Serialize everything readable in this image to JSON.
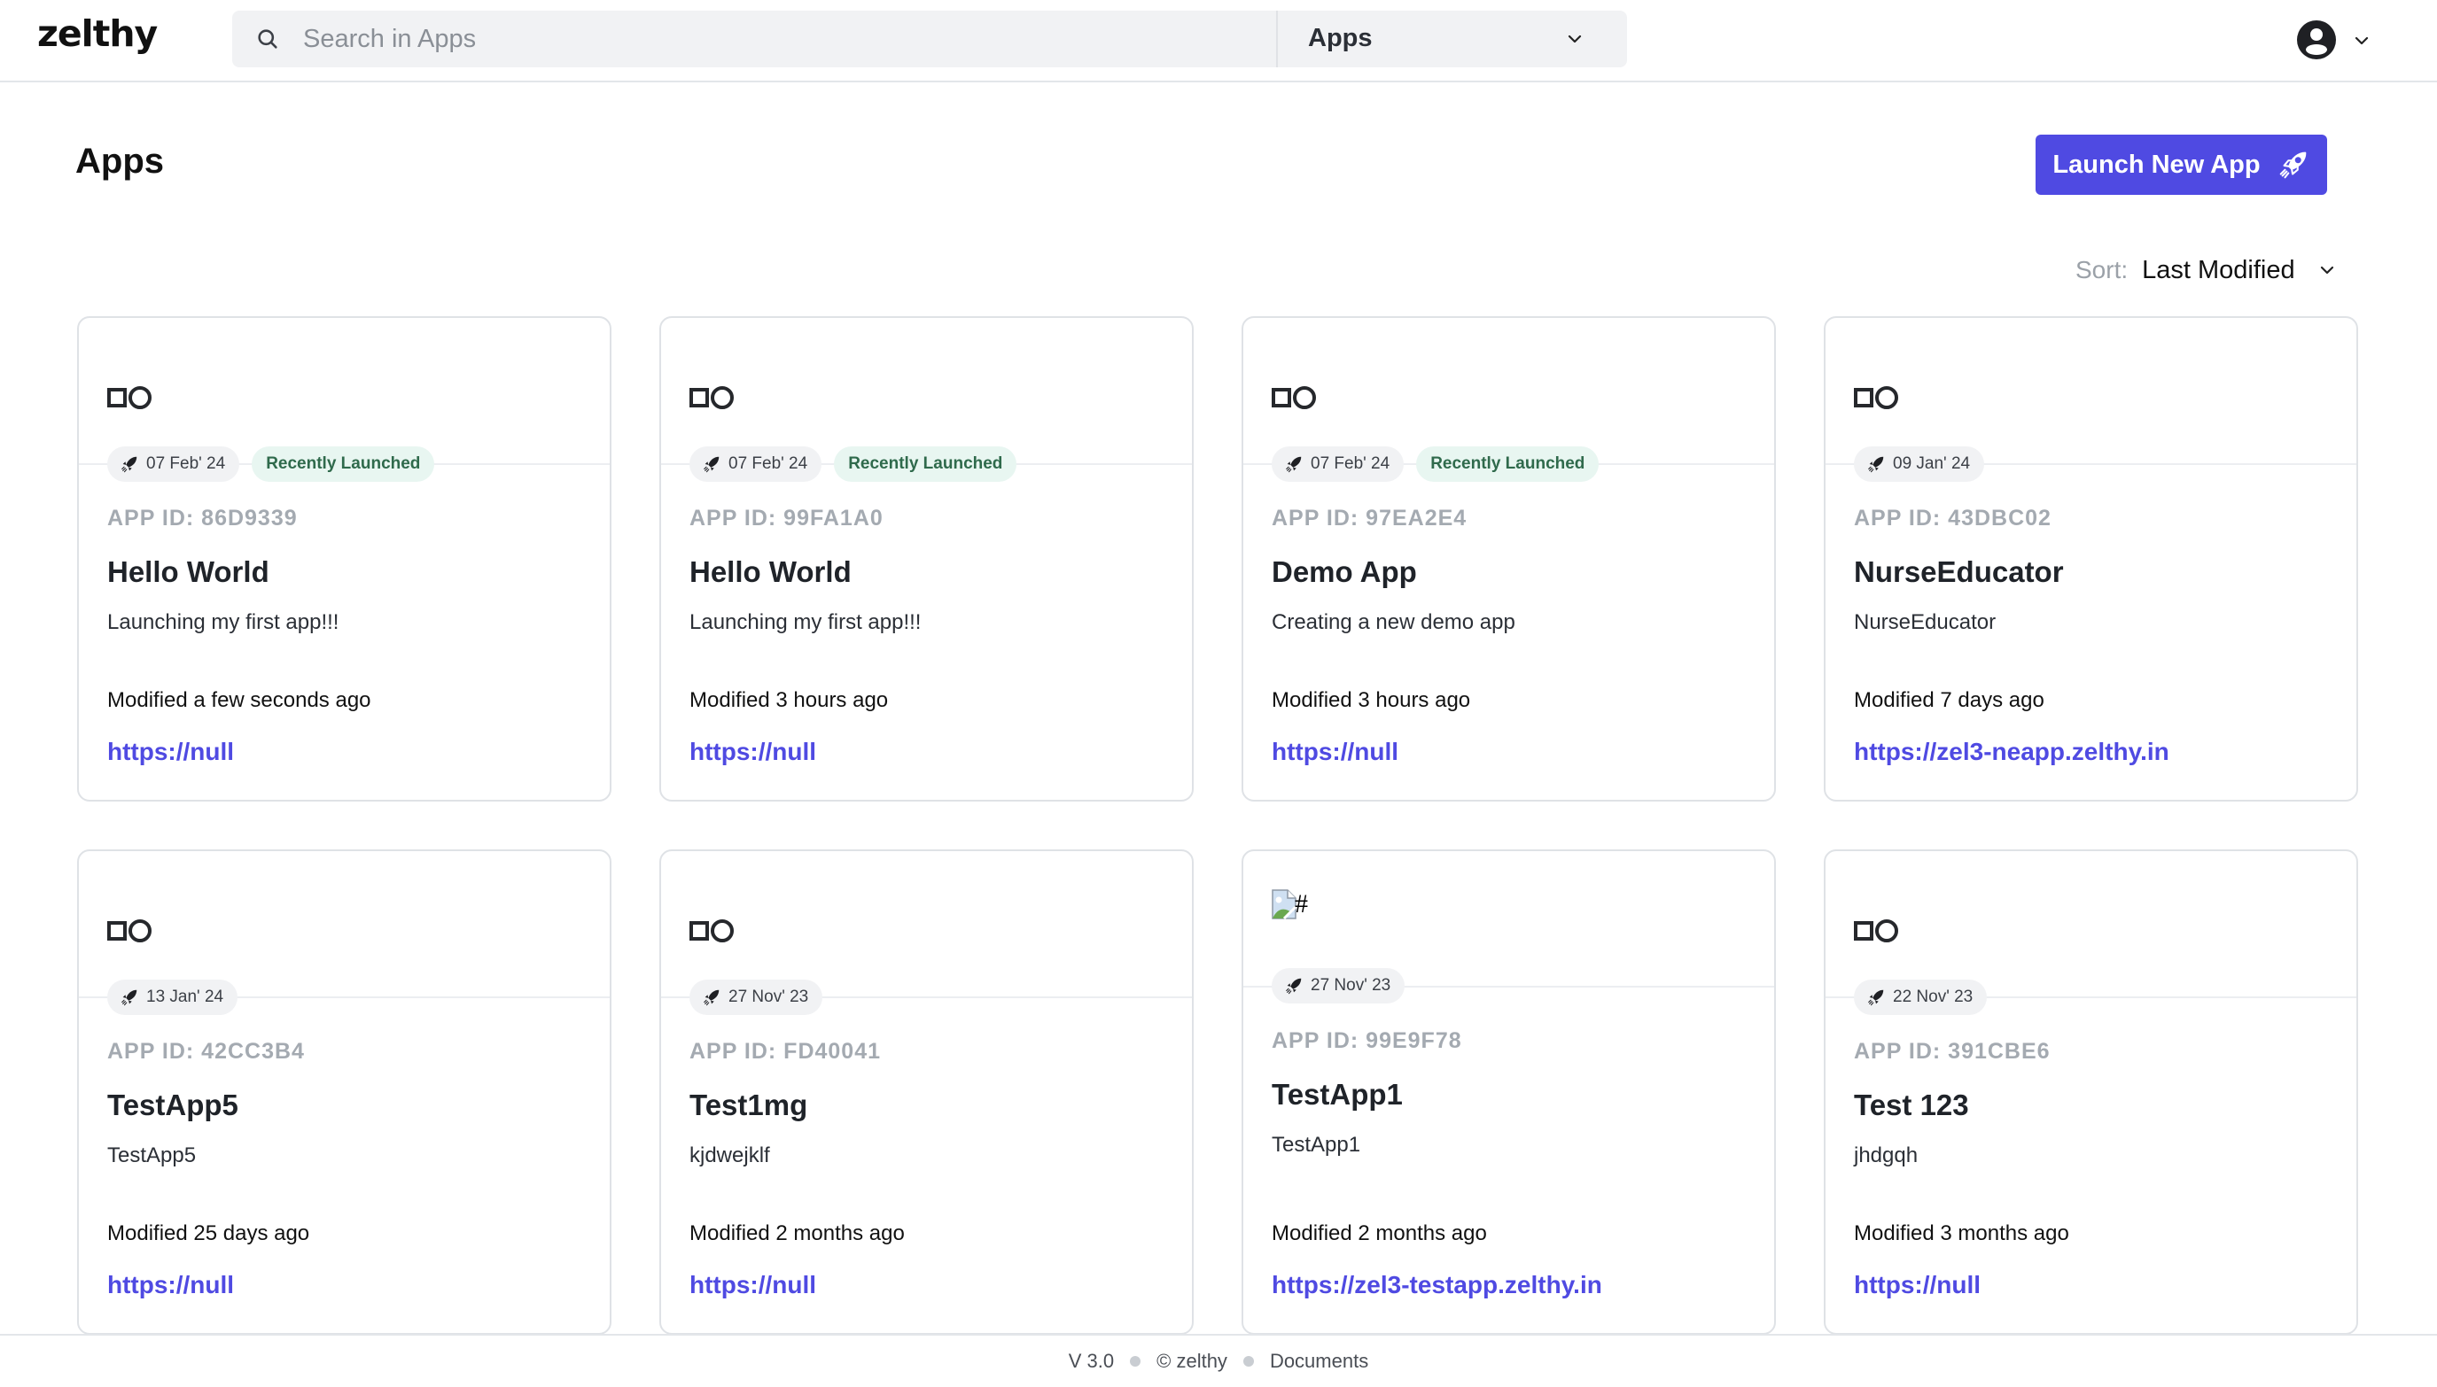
{
  "header": {
    "logo": "zelthy",
    "search_placeholder": "Search in Apps",
    "search_value": "",
    "scope_selected": "Apps",
    "icons": {
      "search": "search-icon",
      "scope": "chevron-down-icon",
      "user": "user-circle-icon",
      "user_menu": "chevron-down-icon"
    }
  },
  "page": {
    "title": "Apps",
    "launch_button": "Launch New App",
    "launch_icon": "rocket-icon",
    "sort_label": "Sort:",
    "sort_value": "Last Modified"
  },
  "colors": {
    "accent": "#4f4ae2",
    "recent_badge_bg": "#e8f6f1",
    "recent_badge_text": "#2f6a4c",
    "app_id_text": "#a4aab1"
  },
  "apps": [
    {
      "logo": "shapes-icon",
      "launched": "07 Feb' 24",
      "badge": "Recently Launched",
      "app_id": "APP ID: 86D9339",
      "name": "Hello World",
      "description": "Launching my first app!!!",
      "modified": "Modified a few seconds ago",
      "url": "https://null"
    },
    {
      "logo": "shapes-icon",
      "launched": "07 Feb' 24",
      "badge": "Recently Launched",
      "app_id": "APP ID: 99FA1A0",
      "name": "Hello World",
      "description": "Launching my first app!!!",
      "modified": "Modified 3 hours ago",
      "url": "https://null"
    },
    {
      "logo": "shapes-icon",
      "launched": "07 Feb' 24",
      "badge": "Recently Launched",
      "app_id": "APP ID: 97EA2E4",
      "name": "Demo App",
      "description": "Creating a new demo app",
      "modified": "Modified 3 hours ago",
      "url": "https://null"
    },
    {
      "logo": "shapes-icon",
      "launched": "09 Jan' 24",
      "badge": null,
      "app_id": "APP ID: 43DBC02",
      "name": "NurseEducator",
      "description": "NurseEducator",
      "modified": "Modified 7 days ago",
      "url": "https://zel3-neapp.zelthy.in"
    },
    {
      "logo": "shapes-icon",
      "launched": "13 Jan' 24",
      "badge": null,
      "app_id": "APP ID: 42CC3B4",
      "name": "TestApp5",
      "description": "TestApp5",
      "modified": "Modified 25 days ago",
      "url": "https://null"
    },
    {
      "logo": "shapes-icon",
      "launched": "27 Nov' 23",
      "badge": null,
      "app_id": "APP ID: FD40041",
      "name": "Test1mg",
      "description": "kjdwejklf",
      "modified": "Modified 2 months ago",
      "url": "https://null"
    },
    {
      "logo": "broken-image-icon",
      "logo_alt": "#",
      "launched": "27 Nov' 23",
      "badge": null,
      "app_id": "APP ID: 99E9F78",
      "name": "TestApp1",
      "description": "TestApp1",
      "modified": "Modified 2 months ago",
      "url": "https://zel3-testapp.zelthy.in"
    },
    {
      "logo": "shapes-icon",
      "launched": "22 Nov' 23",
      "badge": null,
      "app_id": "APP ID: 391CBE6",
      "name": "Test 123",
      "description": "jhdgqh",
      "modified": "Modified 3 months ago",
      "url": "https://null"
    }
  ],
  "footer": {
    "version": "V 3.0",
    "copyright": "© zelthy",
    "documents": "Documents"
  }
}
